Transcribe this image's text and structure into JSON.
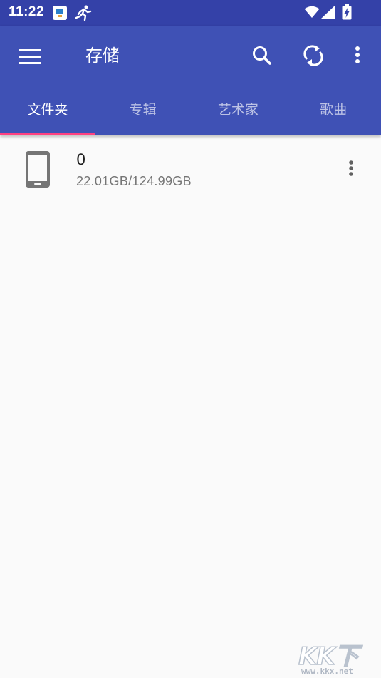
{
  "status_bar": {
    "time": "11:22",
    "icons": [
      "app-notification-icon",
      "running-icon",
      "wifi-icon",
      "cell-signal-icon",
      "battery-charging-icon"
    ]
  },
  "app_bar": {
    "title": "存储",
    "icons": [
      "menu-icon",
      "search-icon",
      "refresh-icon",
      "more-vert-icon"
    ],
    "tabs": [
      {
        "label": "文件夹",
        "active": true
      },
      {
        "label": "专辑",
        "active": false
      },
      {
        "label": "艺术家",
        "active": false
      },
      {
        "label": "歌曲",
        "active": false
      }
    ]
  },
  "storage_list": [
    {
      "icon": "phone-icon",
      "name": "0",
      "size": "22.01GB/124.99GB"
    }
  ],
  "watermark": {
    "logo": "KK下载",
    "url": "www.kkx.net"
  },
  "colors": {
    "status_bar": "#3441a8",
    "app_bar": "#3f51b5",
    "tab_indicator": "#ff4081",
    "background": "#fafafa",
    "icon_gray": "#757575"
  }
}
